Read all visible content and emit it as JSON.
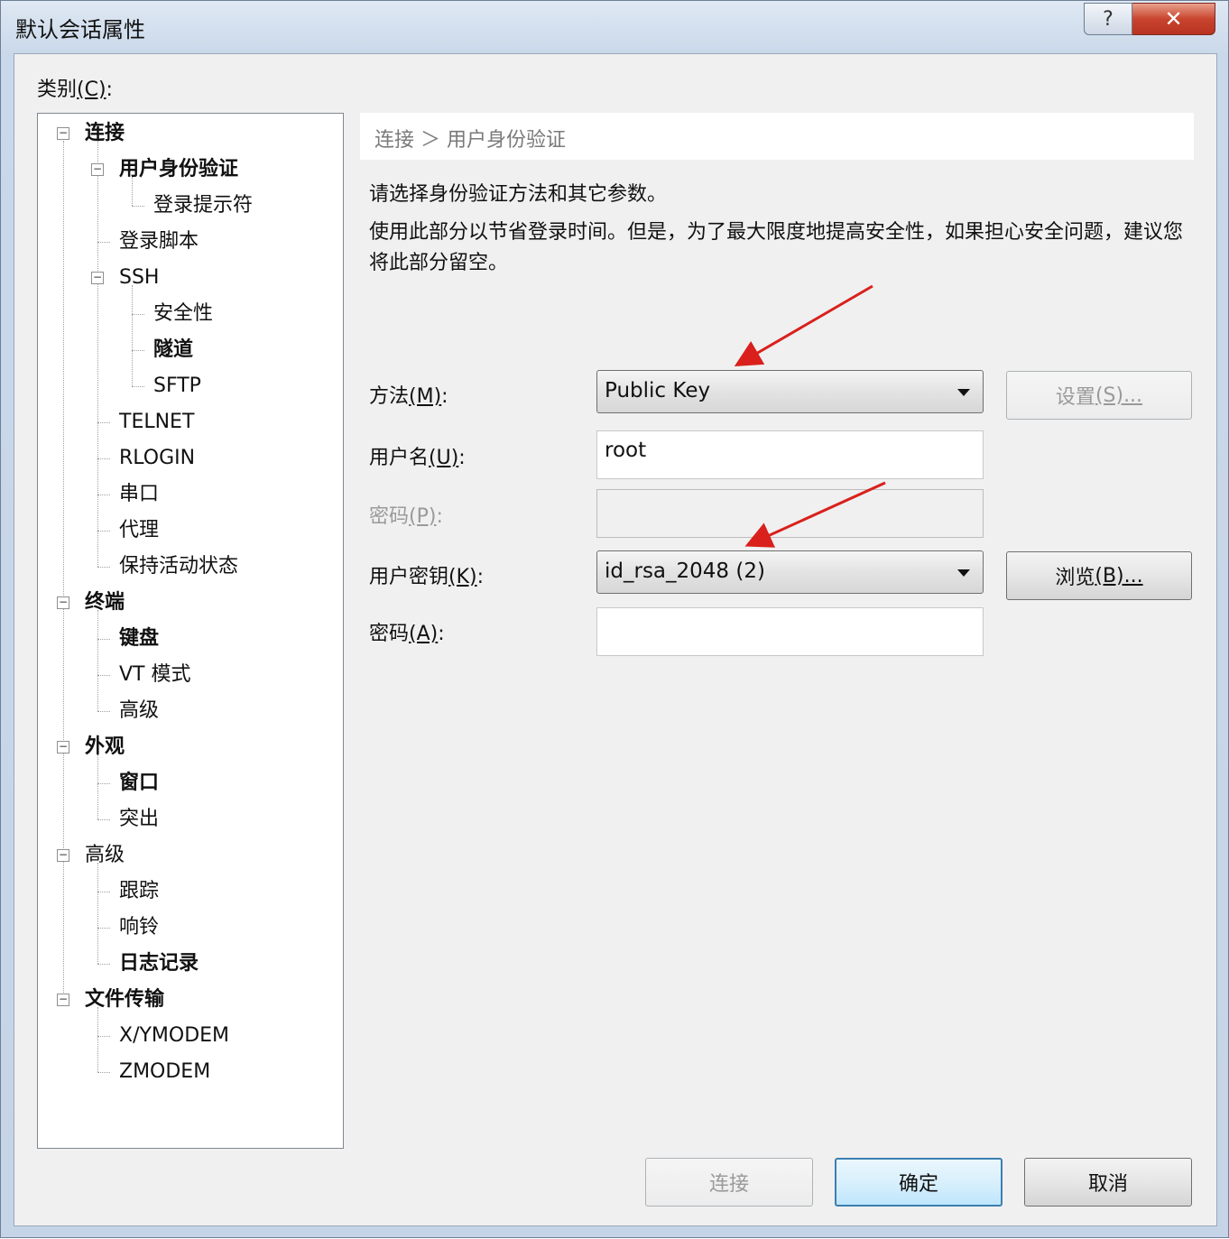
{
  "window": {
    "title": "默认会话属性",
    "help_glyph": "?",
    "close_glyph": "✕"
  },
  "category_label": {
    "text": "类别",
    "mnemonic": "(C)",
    "suffix": ":"
  },
  "tree": [
    {
      "label": "连接",
      "bold": true
    },
    {
      "label": "用户身份验证",
      "bold": true
    },
    {
      "label": "登录提示符",
      "bold": false
    },
    {
      "label": "登录脚本",
      "bold": false
    },
    {
      "label": "SSH",
      "bold": false
    },
    {
      "label": "安全性",
      "bold": false
    },
    {
      "label": "隧道",
      "bold": true
    },
    {
      "label": "SFTP",
      "bold": false
    },
    {
      "label": "TELNET",
      "bold": false
    },
    {
      "label": "RLOGIN",
      "bold": false
    },
    {
      "label": "串口",
      "bold": false
    },
    {
      "label": "代理",
      "bold": false
    },
    {
      "label": "保持活动状态",
      "bold": false
    },
    {
      "label": "终端",
      "bold": true
    },
    {
      "label": "键盘",
      "bold": true
    },
    {
      "label": "VT 模式",
      "bold": false
    },
    {
      "label": "高级",
      "bold": false
    },
    {
      "label": "外观",
      "bold": true
    },
    {
      "label": "窗口",
      "bold": true
    },
    {
      "label": "突出",
      "bold": false
    },
    {
      "label": "高级",
      "bold": false
    },
    {
      "label": "跟踪",
      "bold": false
    },
    {
      "label": "响铃",
      "bold": false
    },
    {
      "label": "日志记录",
      "bold": true
    },
    {
      "label": "文件传输",
      "bold": true
    },
    {
      "label": "X/YMODEM",
      "bold": false
    },
    {
      "label": "ZMODEM",
      "bold": false
    }
  ],
  "breadcrumb": "连接 ＞ 用户身份验证",
  "description": {
    "line1": "请选择身份验证方法和其它参数。",
    "line2": "使用此部分以节省登录时间。但是，为了最大限度地提高安全性，如果担心安全问题，建议您将此部分留空。"
  },
  "form": {
    "method_label": "方法",
    "method_mn": "(M)",
    "method_value": "Public Key",
    "settings_button": "设置",
    "settings_mn": "(S)...",
    "username_label": "用户名",
    "username_mn": "(U)",
    "username_value": "root",
    "password_label": "密码",
    "password_mn": "(P)",
    "userkey_label": "用户密钥",
    "userkey_mn": "(K)",
    "userkey_value": "id_rsa_2048 (2)",
    "browse_button": "浏览",
    "browse_mn": "(B)...",
    "passphrase_label": "密码",
    "passphrase_mn": "(A)",
    "colon": ":"
  },
  "buttons": {
    "connect": "连接",
    "ok": "确定",
    "cancel": "取消"
  },
  "colors": {
    "annotation_arrow": "#d9201c",
    "default_button_border": "#3c7fb1"
  }
}
